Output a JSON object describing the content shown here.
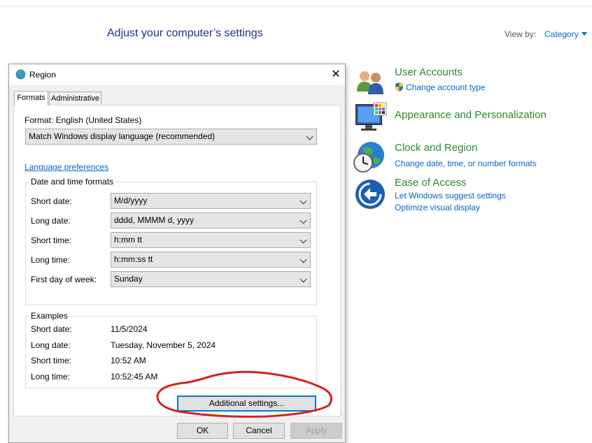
{
  "control_panel": {
    "title": "Adjust your computer’s settings",
    "view_by_label": "View by:",
    "view_by_value": "Category",
    "categories": [
      {
        "name": "user-accounts",
        "title": "User Accounts",
        "links": [
          "Change account type"
        ],
        "icon": "users-icon"
      },
      {
        "name": "appearance",
        "title": "Appearance and Personalization",
        "links": [],
        "icon": "monitor-palette-icon"
      },
      {
        "name": "clock-region",
        "title": "Clock and Region",
        "links": [
          "Change date, time, or number formats"
        ],
        "icon": "globe-clock-icon"
      },
      {
        "name": "ease-of-access",
        "title": "Ease of Access",
        "links": [
          "Let Windows suggest settings",
          "Optimize visual display"
        ],
        "icon": "ease-of-access-icon"
      }
    ]
  },
  "dialog": {
    "title": "Region",
    "close_glyph": "✕",
    "tabs": [
      "Formats",
      "Administrative"
    ],
    "format_label": "Format: English (United States)",
    "format_value": "Match Windows display language (recommended)",
    "language_link": "Language preferences",
    "date_time_group": "Date and time formats",
    "rows": [
      {
        "label": "Short date:",
        "value": "M/d/yyyy"
      },
      {
        "label": "Long date:",
        "value": "dddd, MMMM d, yyyy"
      },
      {
        "label": "Short time:",
        "value": "h:mm tt"
      },
      {
        "label": "Long time:",
        "value": "h:mm:ss tt"
      },
      {
        "label": "First day of week:",
        "value": "Sunday"
      }
    ],
    "examples_group": "Examples",
    "examples": [
      {
        "label": "Short date:",
        "value": "11/5/2024"
      },
      {
        "label": "Long date:",
        "value": "Tuesday, November 5, 2024"
      },
      {
        "label": "Short time:",
        "value": "10:52 AM"
      },
      {
        "label": "Long time:",
        "value": "10:52:45 AM"
      }
    ],
    "additional_settings": "Additional settings...",
    "ok": "OK",
    "cancel": "Cancel",
    "apply": "Apply"
  },
  "annotation": {
    "color": "#d62020"
  }
}
